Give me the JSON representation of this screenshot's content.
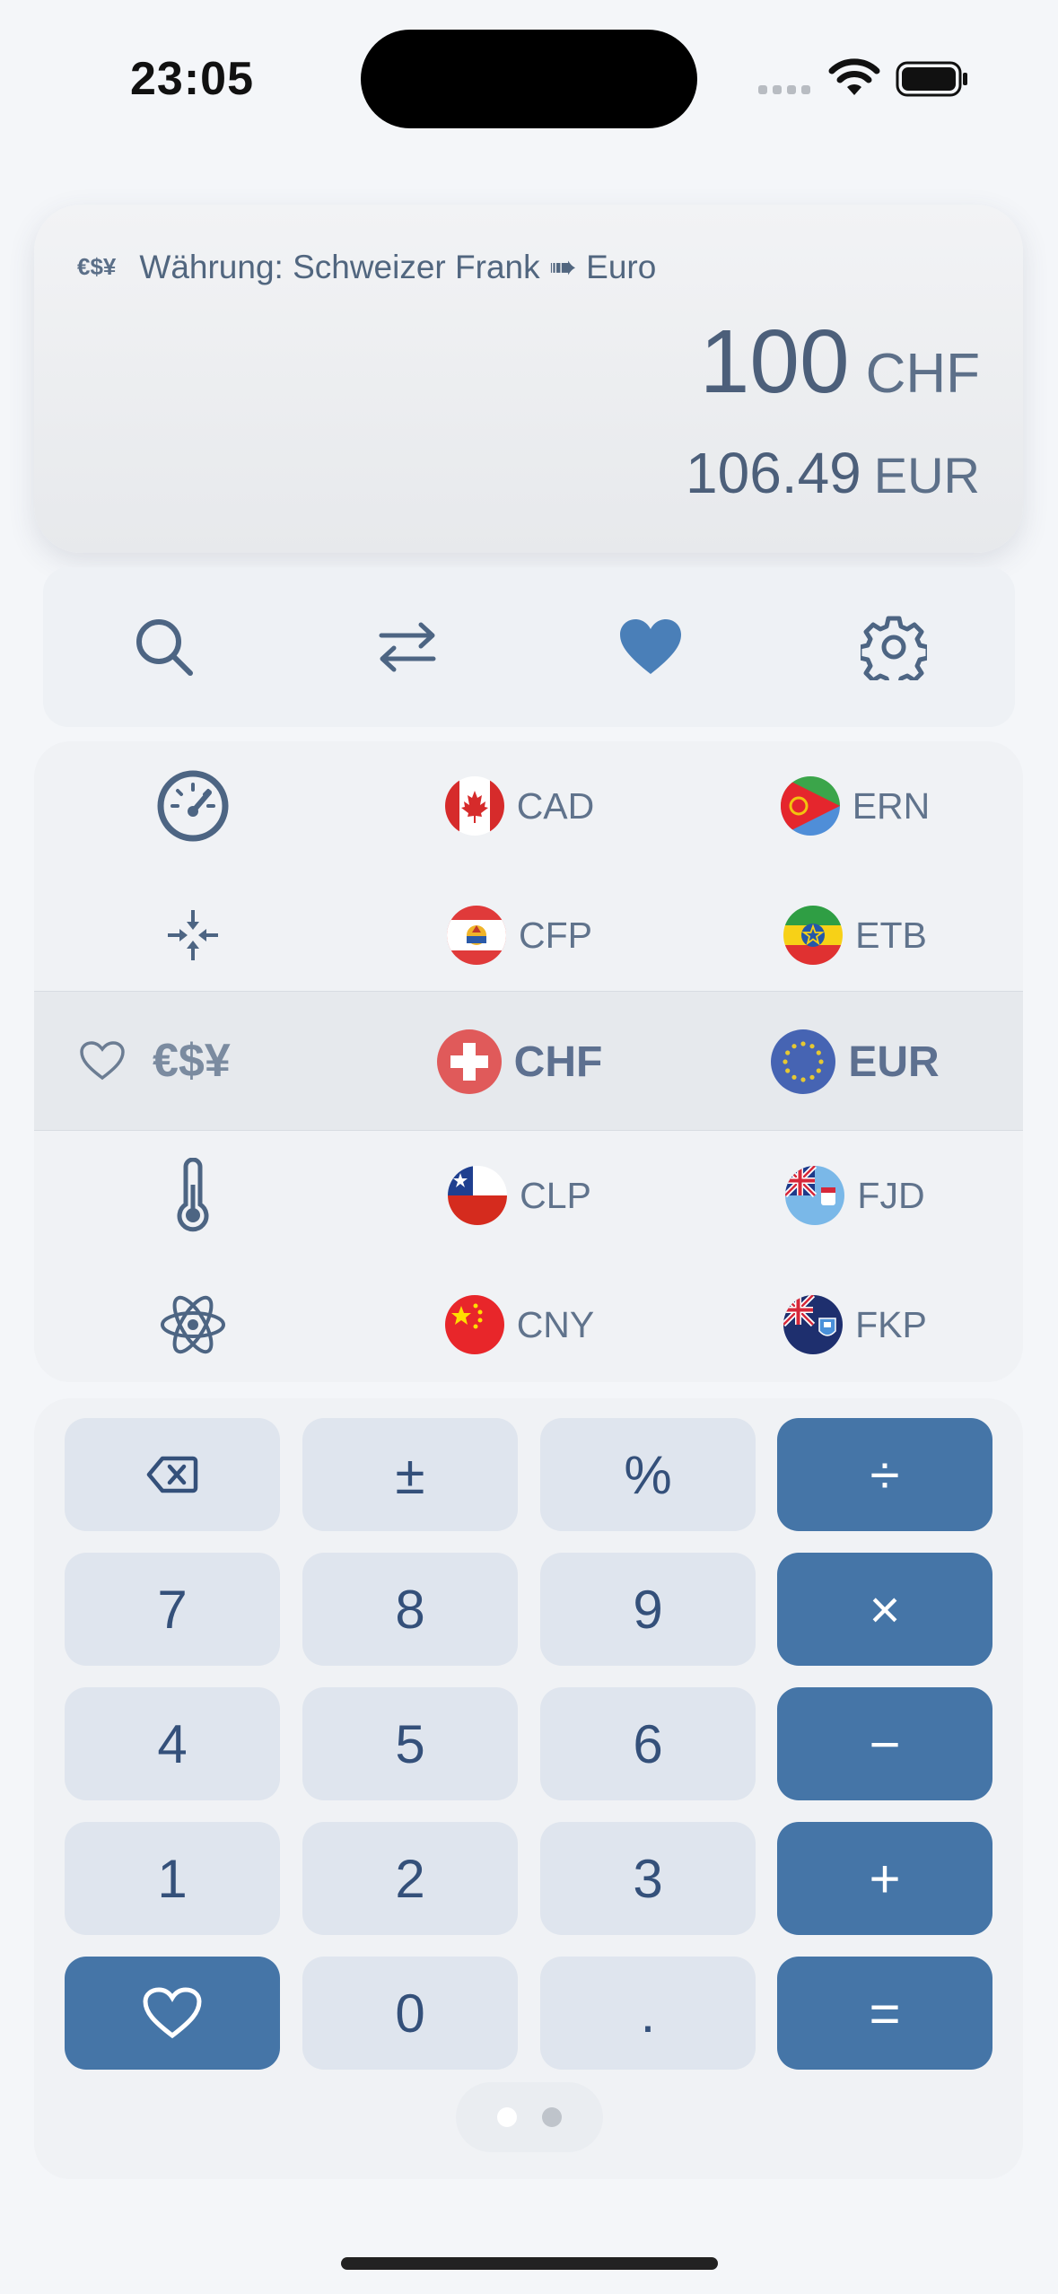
{
  "status_bar": {
    "time": "23:05"
  },
  "display": {
    "mode_icon": "€$¥",
    "title": "Währung: Schweizer Frank ➠ Euro",
    "input_value": "100",
    "input_unit": "CHF",
    "output_value": "106.49",
    "output_unit": "EUR"
  },
  "toolbar": {
    "icons": [
      "search-icon",
      "swap-arrows-icon",
      "heart-filled-icon",
      "gear-icon"
    ]
  },
  "picker": {
    "categories": {
      "items": [
        "gauge-icon",
        "compress-arrows-icon",
        "€$¥",
        "thermometer-icon",
        "atom-icon"
      ],
      "selected_label": "€$¥"
    },
    "from_currencies": [
      {
        "code": "CAD",
        "flag": "canada-flag-icon"
      },
      {
        "code": "CFP",
        "flag": "french-polynesia-flag-icon"
      },
      {
        "code": "CHF",
        "flag": "switzerland-flag-icon"
      },
      {
        "code": "CLP",
        "flag": "chile-flag-icon"
      },
      {
        "code": "CNY",
        "flag": "china-flag-icon"
      }
    ],
    "to_currencies": [
      {
        "code": "ERN",
        "flag": "eritrea-flag-icon"
      },
      {
        "code": "ETB",
        "flag": "ethiopia-flag-icon"
      },
      {
        "code": "EUR",
        "flag": "eu-flag-icon"
      },
      {
        "code": "FJD",
        "flag": "fiji-flag-icon"
      },
      {
        "code": "FKP",
        "flag": "falkland-flag-icon"
      }
    ]
  },
  "keypad": {
    "keys": {
      "backspace": "⌫",
      "plusminus": "±",
      "percent": "%",
      "divide": "÷",
      "seven": "7",
      "eight": "8",
      "nine": "9",
      "multiply": "×",
      "four": "4",
      "five": "5",
      "six": "6",
      "minus": "−",
      "one": "1",
      "two": "2",
      "three": "3",
      "plus": "+",
      "zero": "0",
      "dot": ".",
      "equals": "="
    }
  },
  "colors": {
    "accent": "#4575a7",
    "key_bg": "#dfe5ee",
    "text": "#4a5f7a",
    "heart": "#4a7fb8"
  }
}
